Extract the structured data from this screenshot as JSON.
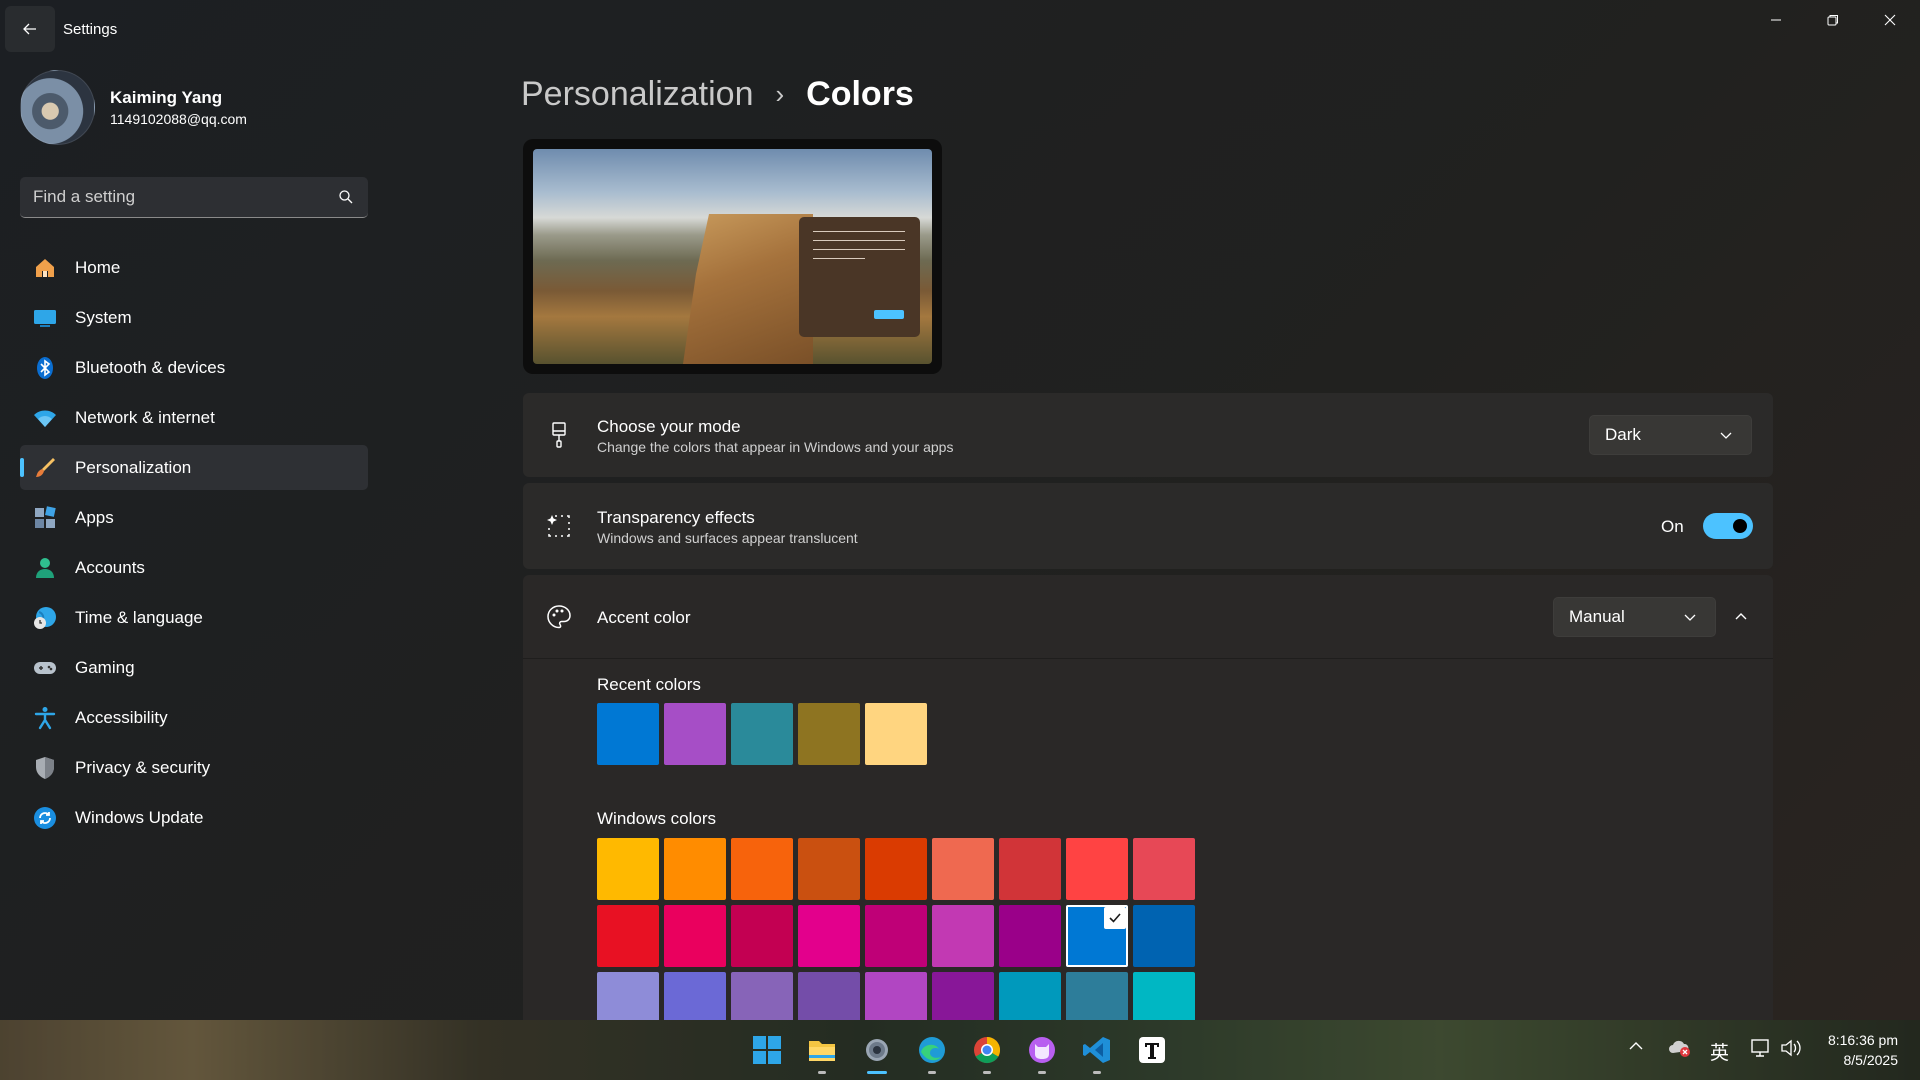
{
  "window": {
    "title": "Settings"
  },
  "profile": {
    "name": "Kaiming Yang",
    "email": "1149102088@qq.com"
  },
  "search": {
    "placeholder": "Find a setting"
  },
  "sidebar": {
    "items": [
      {
        "label": "Home",
        "icon": "home-icon"
      },
      {
        "label": "System",
        "icon": "system-icon"
      },
      {
        "label": "Bluetooth & devices",
        "icon": "bluetooth-icon"
      },
      {
        "label": "Network & internet",
        "icon": "wifi-icon"
      },
      {
        "label": "Personalization",
        "icon": "brush-icon",
        "active": true
      },
      {
        "label": "Apps",
        "icon": "apps-icon"
      },
      {
        "label": "Accounts",
        "icon": "account-icon"
      },
      {
        "label": "Time & language",
        "icon": "globe-clock-icon"
      },
      {
        "label": "Gaming",
        "icon": "gamepad-icon"
      },
      {
        "label": "Accessibility",
        "icon": "accessibility-icon"
      },
      {
        "label": "Privacy & security",
        "icon": "shield-icon"
      },
      {
        "label": "Windows Update",
        "icon": "update-icon"
      }
    ]
  },
  "breadcrumb": {
    "parent": "Personalization",
    "separator": "›",
    "current": "Colors"
  },
  "settings": {
    "mode": {
      "title": "Choose your mode",
      "subtitle": "Change the colors that appear in Windows and your apps",
      "value": "Dark"
    },
    "transparency": {
      "title": "Transparency effects",
      "subtitle": "Windows and surfaces appear translucent",
      "state_label": "On",
      "enabled": true
    },
    "accent": {
      "title": "Accent color",
      "value": "Manual",
      "expanded": true
    }
  },
  "recent_colors": {
    "label": "Recent colors",
    "colors": [
      "#0078d4",
      "#a64ec6",
      "#2a8a9a",
      "#8e7421",
      "#ffd580"
    ]
  },
  "windows_colors": {
    "label": "Windows colors",
    "selected_index": 16,
    "colors": [
      "#ffb900",
      "#ff8c00",
      "#f7630c",
      "#ca5010",
      "#da3b01",
      "#ef6950",
      "#d13438",
      "#ff4343",
      "#e74856",
      "#e81123",
      "#ea005e",
      "#c30052",
      "#e3008c",
      "#bf0077",
      "#c239b3",
      "#9a0089",
      "#0078d4",
      "#0063b1",
      "#8e8cd8",
      "#6b69d6",
      "#8764b8",
      "#744da9",
      "#b146c2",
      "#881798",
      "#0099bc",
      "#2d7d9a",
      "#00b7c3"
    ]
  },
  "accent_color": "#4cc2ff",
  "taskbar": {
    "apps": [
      "windows-start-icon",
      "file-explorer-icon",
      "settings-icon",
      "edge-icon",
      "chrome-icon",
      "cat-app-icon",
      "vscode-icon",
      "typora-icon"
    ],
    "ime": "英",
    "time": "8:16:36 pm",
    "date": "8/5/2025"
  }
}
